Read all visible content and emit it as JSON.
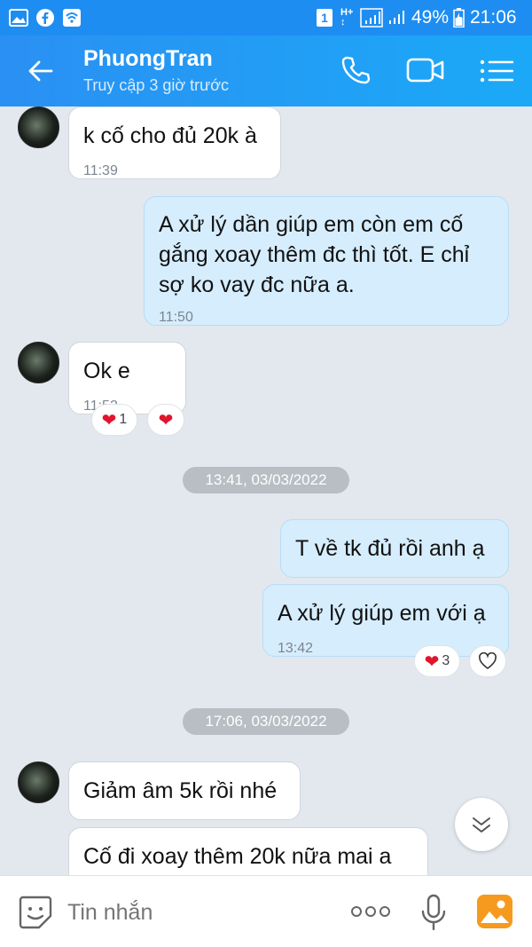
{
  "status": {
    "battery": "49%",
    "time": "21:06",
    "sim": "1"
  },
  "header": {
    "name": "PhuongTran",
    "subtitle": "Truy cập 3 giờ trước"
  },
  "messages": [
    {
      "text": "k cố cho đủ 20k à",
      "time": "11:39"
    },
    {
      "text": "A xử lý dần giúp em còn em cố gắng xoay thêm đc thì tốt. E chỉ sợ ko vay đc nữa a.",
      "time": "11:50"
    },
    {
      "text": "Ok e",
      "time": "11:52",
      "reaction_count": "1"
    },
    {
      "text": "T về tk đủ rồi anh ạ"
    },
    {
      "text": "A xử lý giúp em với ạ",
      "time": "13:42",
      "reaction_count": "3"
    },
    {
      "text": "Giảm âm 5k rồi nhé"
    },
    {
      "text": "Cố đi xoay thêm 20k nữa mai a"
    }
  ],
  "separators": [
    "13:41, 03/03/2022",
    "17:06, 03/03/2022"
  ],
  "input": {
    "placeholder": "Tin nhắn"
  },
  "colors": {
    "header": "#1e8df2",
    "outgoing": "#d6edfd",
    "background": "#e2e8ee"
  }
}
